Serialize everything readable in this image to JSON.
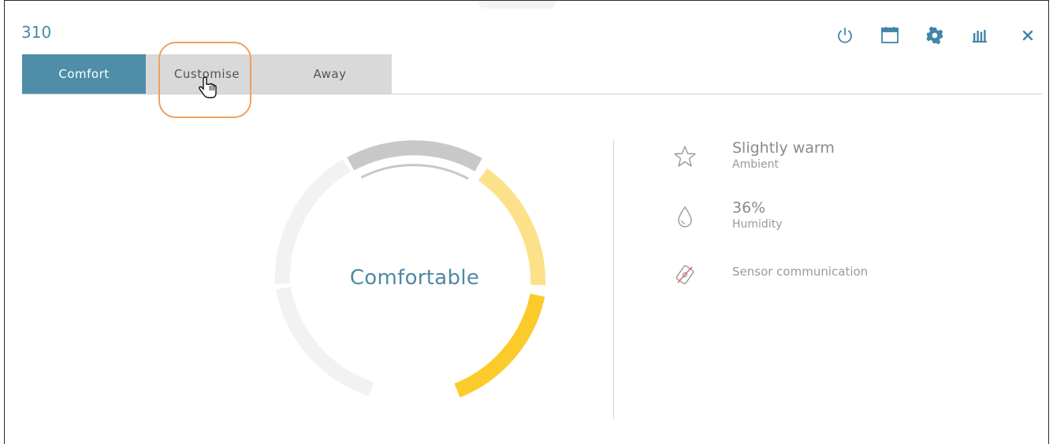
{
  "window": {
    "title": "310"
  },
  "toolbar": {
    "icons": [
      "power-icon",
      "calendar-icon",
      "gear-icon",
      "chart-icon",
      "close-icon"
    ],
    "accent": "#3f86a8"
  },
  "tabs": [
    {
      "label": "Comfort",
      "active": true
    },
    {
      "label": "Customise",
      "active": false
    },
    {
      "label": "Away",
      "active": false
    }
  ],
  "gauge": {
    "status": "Comfortable",
    "colors": {
      "track": "#f2f2f2",
      "top": "#c8c8c8",
      "warm": "#fde08a",
      "hot": "#fbcb2c",
      "text": "#4d8aa3"
    }
  },
  "info": {
    "ambient": {
      "value": "Slightly warm",
      "label": "Ambient",
      "icon": "star-icon"
    },
    "humidity": {
      "value": "36%",
      "label": "Humidity",
      "icon": "droplet-icon"
    },
    "sensor": {
      "label": "Sensor communication",
      "icon": "sensor-off-icon"
    }
  }
}
